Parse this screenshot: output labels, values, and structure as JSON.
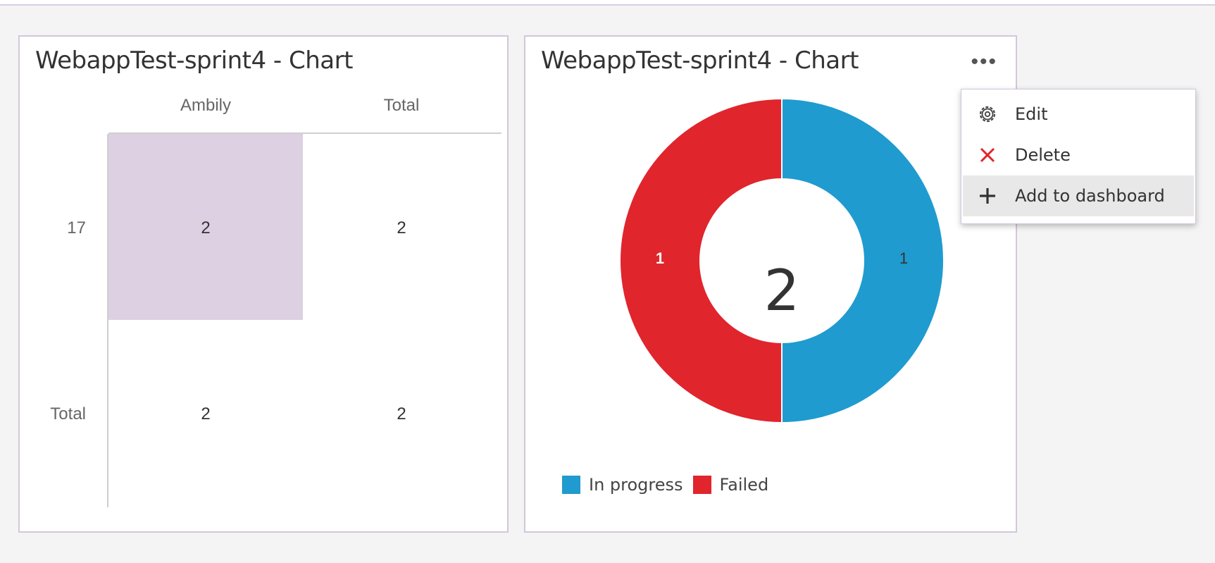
{
  "pivot_widget": {
    "title": "WebappTest-sprint4 - Chart",
    "columns": [
      "Ambily",
      "Total"
    ],
    "rows": [
      {
        "label": "17",
        "values": [
          "2",
          "2"
        ]
      },
      {
        "label": "Total",
        "values": [
          "2",
          "2"
        ]
      }
    ]
  },
  "pie_widget": {
    "title": "WebappTest-sprint4 - Chart",
    "more_icon": "ellipsis-icon",
    "center_total": "2",
    "slice_labels": [
      "1",
      "1"
    ],
    "legend": [
      "In progress",
      "Failed"
    ]
  },
  "context_menu": {
    "items": [
      {
        "label": "Edit",
        "icon": "gear-icon"
      },
      {
        "label": "Delete",
        "icon": "close-icon"
      },
      {
        "label": "Add to dashboard",
        "icon": "plus-icon"
      }
    ]
  },
  "colors": {
    "in_progress": "#1f9bcf",
    "failed": "#e0252d",
    "highlight": "#dcd0e2"
  },
  "chart_data": {
    "type": "pie",
    "variant": "donut",
    "categories": [
      "In progress",
      "Failed"
    ],
    "values": [
      1,
      1
    ],
    "total": 2,
    "title": "WebappTest-sprint4 - Chart",
    "legend_position": "bottom-left"
  }
}
